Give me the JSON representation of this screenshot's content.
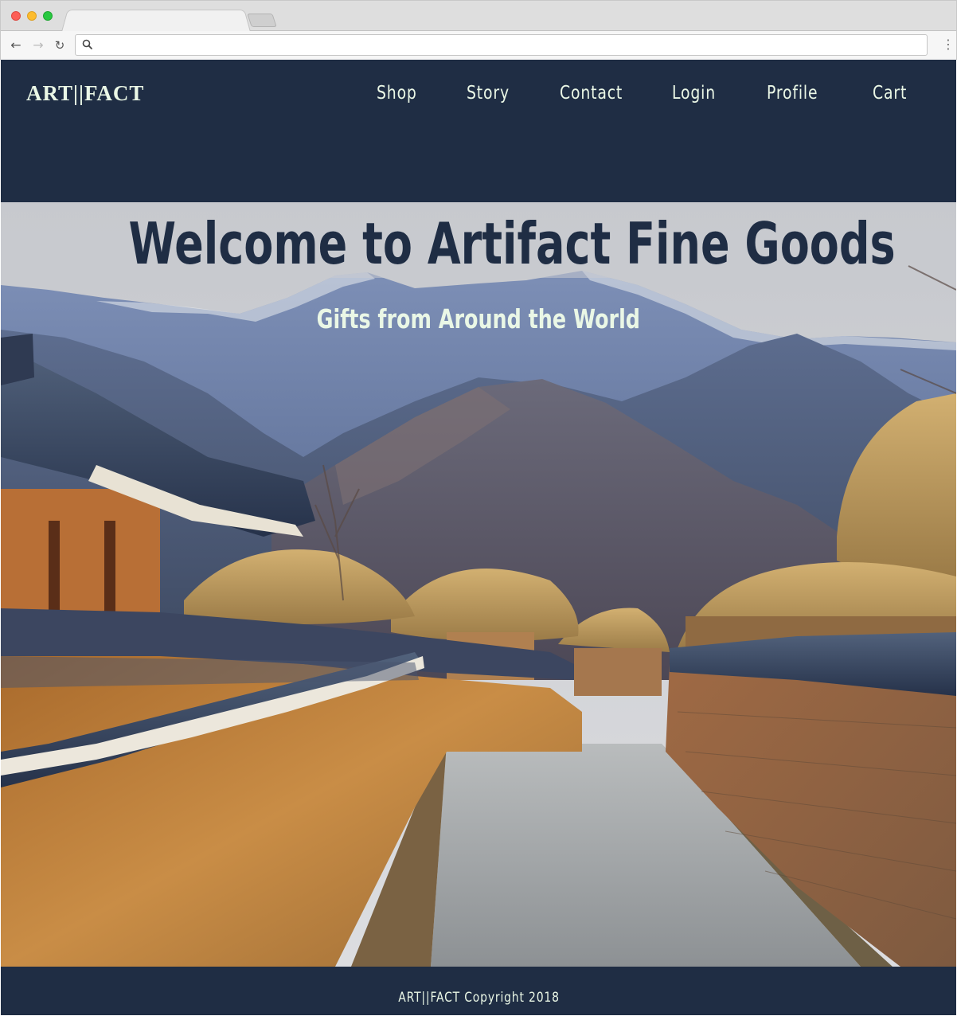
{
  "browser": {
    "address_value": "",
    "icons": {
      "back": "arrow-left-icon",
      "forward": "arrow-right-icon",
      "reload": "reload-icon",
      "search": "search-icon",
      "menu": "kebab-menu-icon"
    }
  },
  "site": {
    "logo": "ART||FACT",
    "nav": [
      {
        "label": "Shop"
      },
      {
        "label": "Story"
      },
      {
        "label": "Contact"
      },
      {
        "label": "Login"
      },
      {
        "label": "Profile"
      },
      {
        "label": "Cart"
      }
    ],
    "hero": {
      "title": "Welcome to Artifact Fine Goods",
      "subtitle": "Gifts from Around the World"
    },
    "footer": "ART||FACT Copyright 2018",
    "colors": {
      "navy": "#1f2d44",
      "mint_text": "#eaf7e6"
    }
  }
}
